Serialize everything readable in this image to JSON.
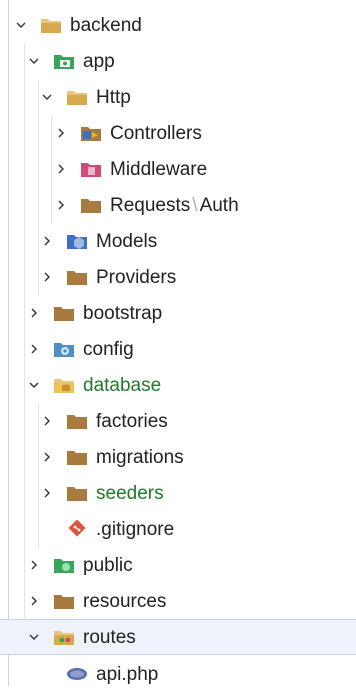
{
  "tree": {
    "backend": "backend",
    "app": "app",
    "http": "Http",
    "controllers": "Controllers",
    "middleware": "Middleware",
    "requests": "Requests",
    "path_sep": "\\",
    "auth": "Auth",
    "models": "Models",
    "providers": "Providers",
    "bootstrap": "bootstrap",
    "config": "config",
    "database": "database",
    "factories": "factories",
    "migrations": "migrations",
    "seeders": "seeders",
    "gitignore": ".gitignore",
    "public": "public",
    "resources": "resources",
    "routes": "routes",
    "api": "api.php"
  },
  "colors": {
    "folder": "#a87a3e",
    "folder_open": "#d9a94f",
    "highlight_text": "#1f7a2a",
    "selection": "#eef2fa"
  }
}
